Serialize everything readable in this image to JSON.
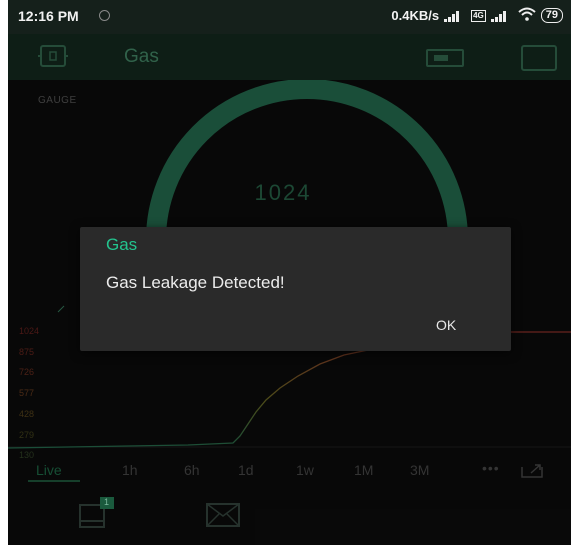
{
  "status_bar": {
    "time": "12:16 PM",
    "network_speed": "0.4KB/s",
    "battery": "79",
    "icons": [
      "notification-dot-icon",
      "signal-icon",
      "volte-icon",
      "wifi-icon",
      "battery-icon"
    ]
  },
  "app_bar": {
    "title": "Gas",
    "left_icon": "device-tablet-icon",
    "right_icons": [
      "battery-icon",
      "square-icon"
    ]
  },
  "gauge": {
    "label": "GAUGE",
    "value": "1024",
    "color": "#1f5c43"
  },
  "chart": {
    "y_labels": [
      "1024",
      "875",
      "726",
      "577",
      "428",
      "279",
      "130"
    ],
    "y_label_colors": [
      "#5a1d1a",
      "#5a211a",
      "#5a271a",
      "#5a331a",
      "#4a3a18",
      "#3b3a18",
      "#2b3a22"
    ],
    "line_color_low": "#1f5c43",
    "line_color_high": "#7a2a24"
  },
  "time_tabs": {
    "items": [
      "Live",
      "1h",
      "6h",
      "1d",
      "1w",
      "1M",
      "3M"
    ],
    "selected": "Live",
    "more_icon": "more-horizontal-icon",
    "export_icon": "export-icon"
  },
  "bottom_bar": {
    "icons": [
      "tablet-notification-icon",
      "mail-icon"
    ],
    "badge": "1"
  },
  "dialog": {
    "title": "Gas",
    "message": "Gas Leakage Detected!",
    "ok_label": "OK"
  },
  "accent_color": "#23c48e"
}
